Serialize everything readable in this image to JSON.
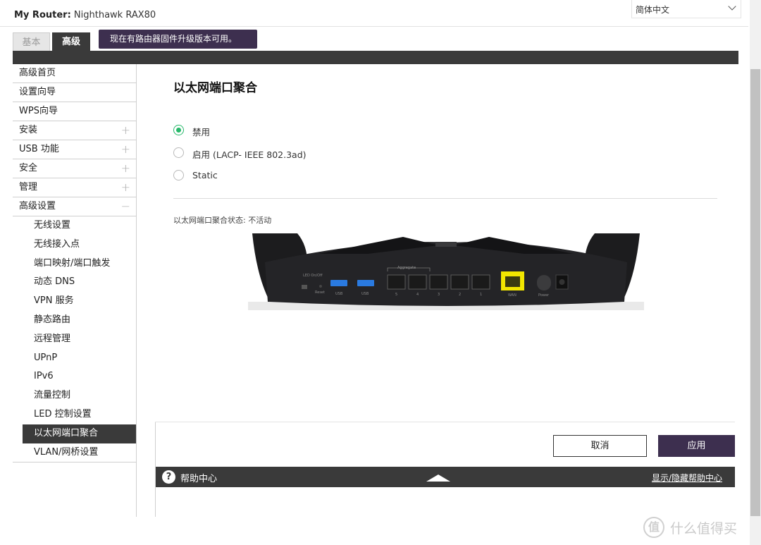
{
  "header": {
    "router_prefix": "My Router:",
    "router_name": "Nighthawk RAX80",
    "language": "简体中文"
  },
  "tabs": {
    "basic": "基本",
    "advanced": "高级"
  },
  "notice": "现在有路由器固件升级版本可用。",
  "sidebar": {
    "items": [
      {
        "label": "高级首页",
        "expander": ""
      },
      {
        "label": "设置向导",
        "expander": ""
      },
      {
        "label": "WPS向导",
        "expander": ""
      },
      {
        "label": "安装",
        "expander": "+"
      },
      {
        "label": "USB 功能",
        "expander": "+"
      },
      {
        "label": "安全",
        "expander": "+"
      },
      {
        "label": "管理",
        "expander": "+"
      },
      {
        "label": "高级设置",
        "expander": "−"
      }
    ],
    "subitems": [
      "无线设置",
      "无线接入点",
      "端口映射/端口触发",
      "动态 DNS",
      "VPN 服务",
      "静态路由",
      "远程管理",
      "UPnP",
      "IPv6",
      "流量控制",
      "LED 控制设置",
      "以太网端口聚合",
      "VLAN/网桥设置"
    ],
    "active_subitem": "以太网端口聚合"
  },
  "main": {
    "title": "以太网端口聚合",
    "options": [
      {
        "label": "禁用",
        "checked": true
      },
      {
        "label": "启用 (LACP- IEEE 802.3ad)",
        "checked": false
      },
      {
        "label": "Static",
        "checked": false
      }
    ],
    "status_label": "以太网端口聚合状态:",
    "status_value": "不活动",
    "router_panel": {
      "led": "LED On/Off",
      "reset": "Reset",
      "usb1": "USB",
      "usb2": "USB",
      "aggregate": "Aggregate",
      "ports": [
        "5",
        "4",
        "3",
        "2",
        "1"
      ],
      "wan": "WAN",
      "power": "Power"
    },
    "cancel_label": "取消",
    "apply_label": "应用"
  },
  "help": {
    "icon": "?",
    "label": "帮助中心",
    "toggle": "显示/隐藏帮助中心"
  },
  "watermark": {
    "logo": "值",
    "text": "什么值得买"
  },
  "colors": {
    "accent": "#3d2f4f",
    "dark": "#3a3a3a",
    "radio_checked": "#27b86a",
    "wan_port": "#f2e600"
  }
}
